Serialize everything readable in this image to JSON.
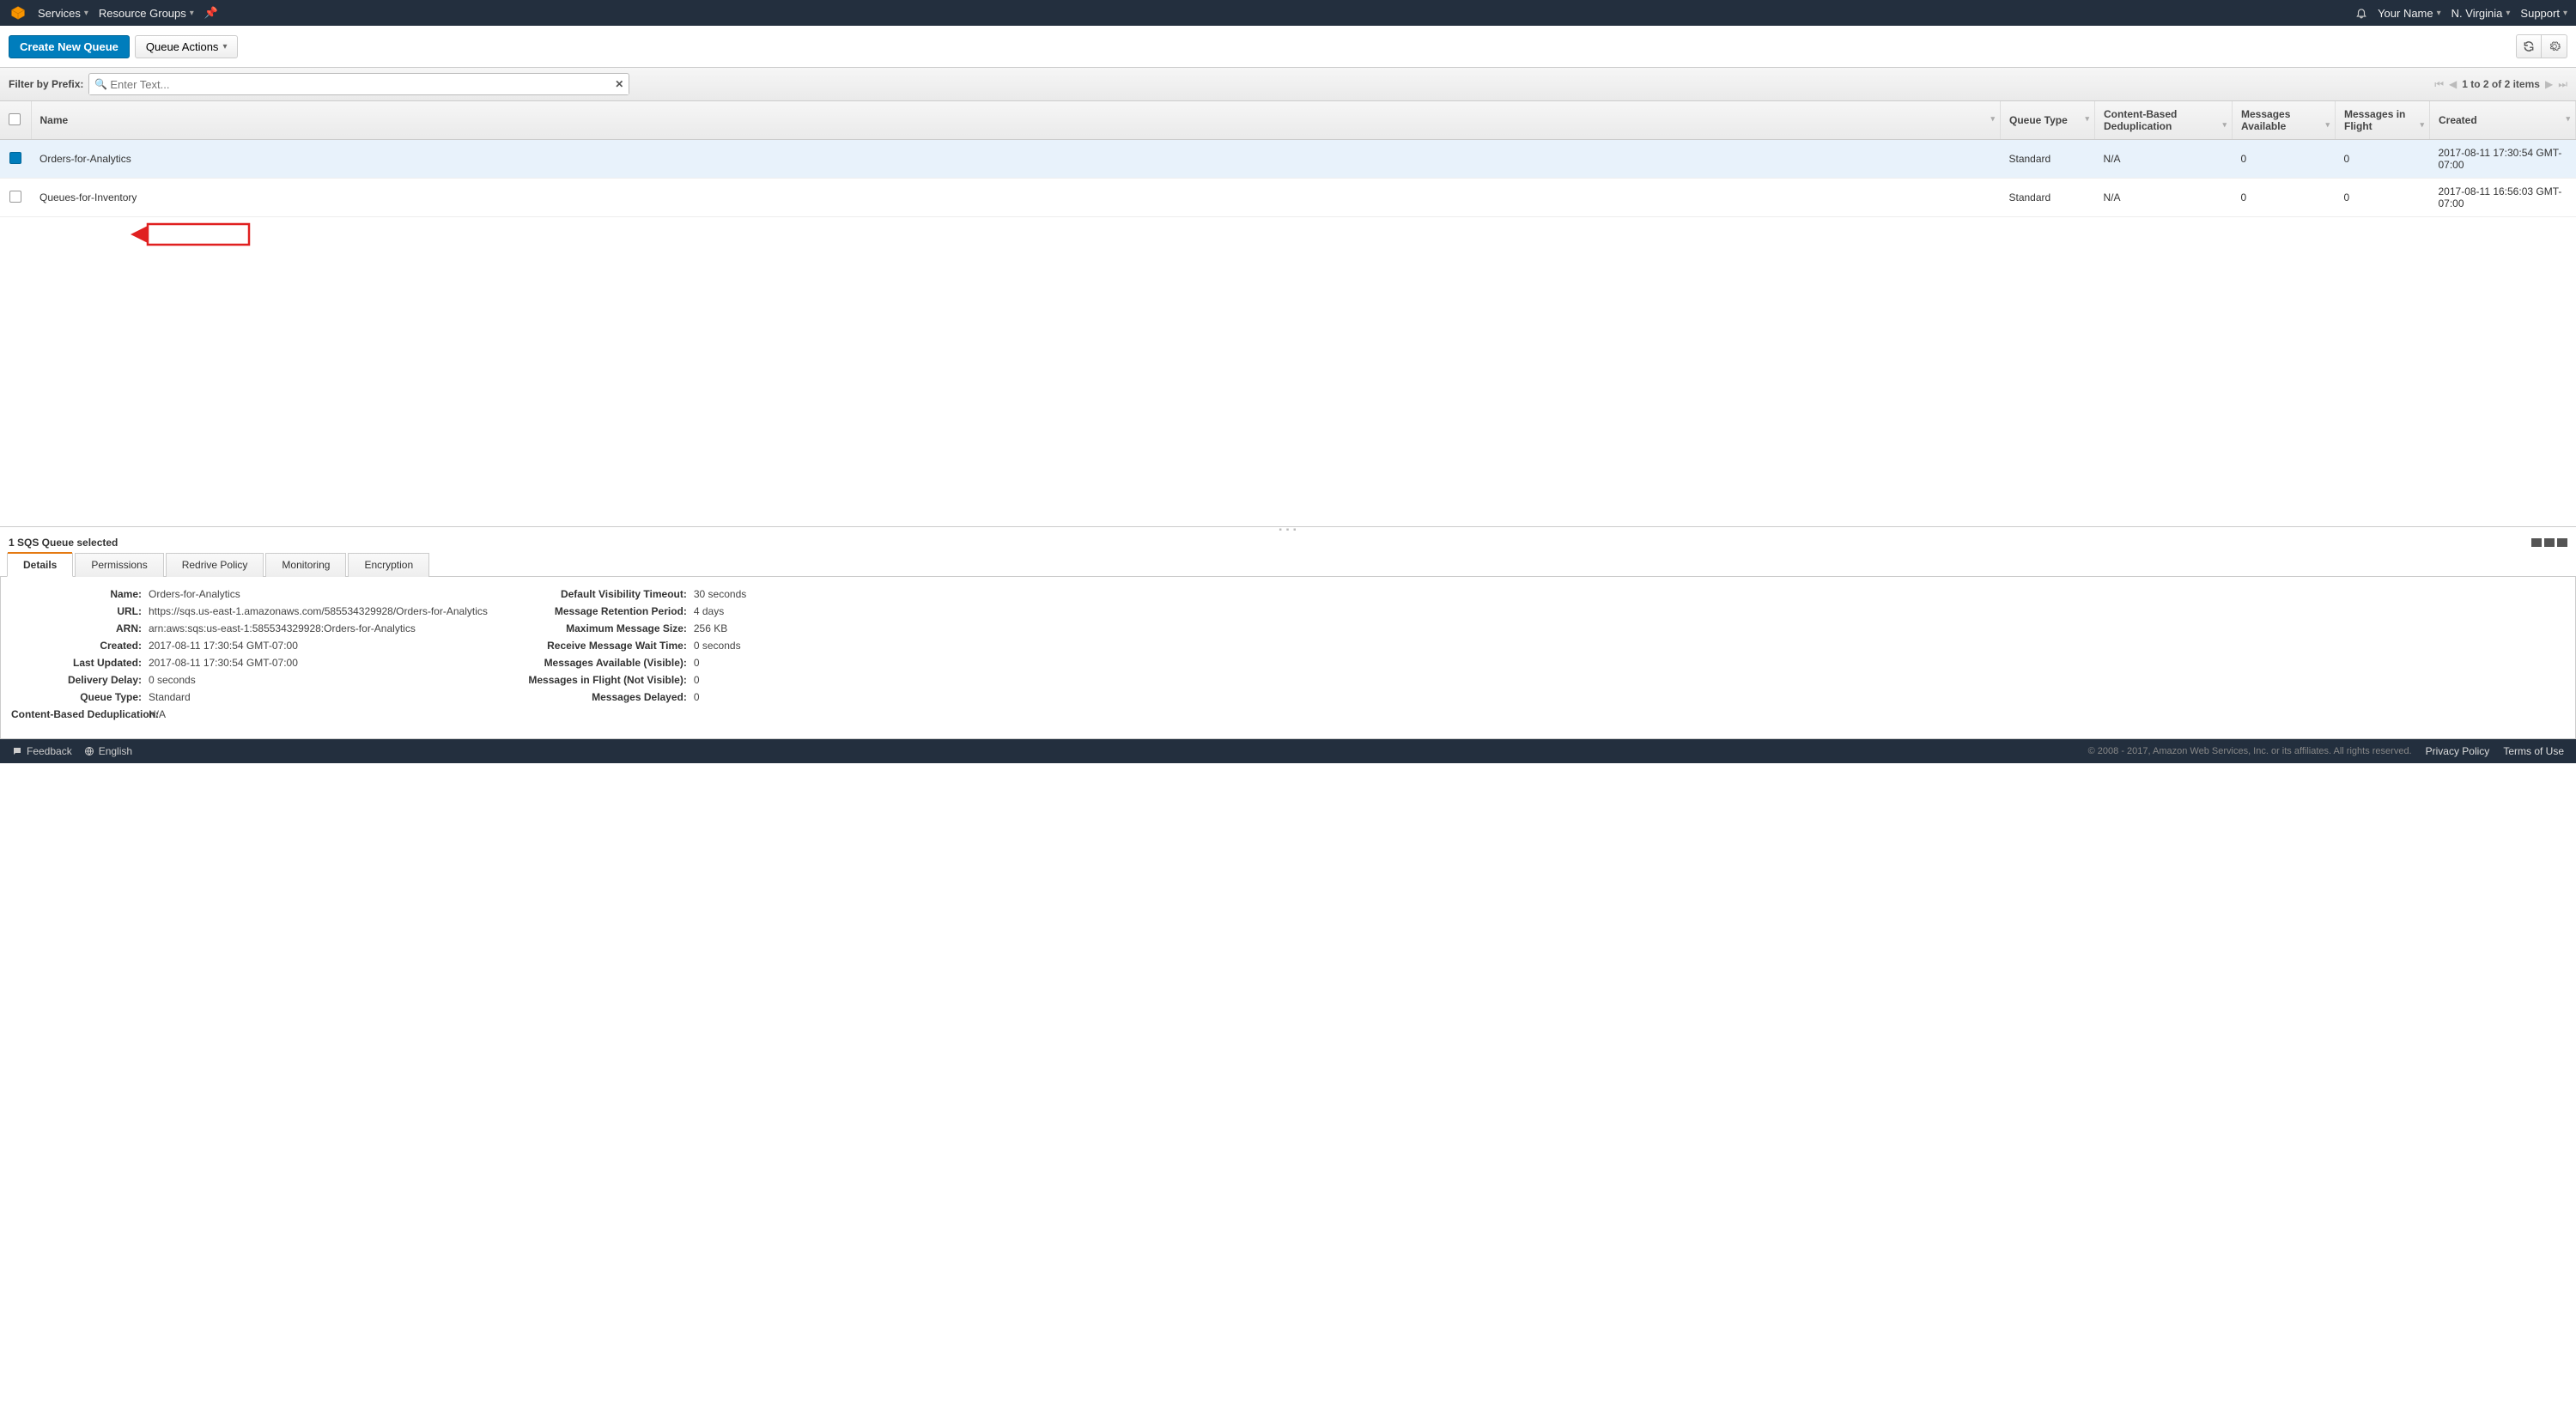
{
  "topnav": {
    "services": "Services",
    "resource_groups": "Resource Groups",
    "user": "Your Name",
    "region": "N. Virginia",
    "support": "Support"
  },
  "actionbar": {
    "create": "Create New Queue",
    "actions": "Queue Actions"
  },
  "filter": {
    "label": "Filter by Prefix:",
    "placeholder": "Enter Text..."
  },
  "pager": {
    "text": "1 to 2 of 2 items"
  },
  "table": {
    "headers": {
      "name": "Name",
      "type": "Queue Type",
      "dedup": "Content-Based Deduplication",
      "available": "Messages Available",
      "inflight": "Messages in Flight",
      "created": "Created"
    },
    "rows": [
      {
        "selected": true,
        "name": "Orders-for-Analytics",
        "type": "Standard",
        "dedup": "N/A",
        "available": "0",
        "inflight": "0",
        "created": "2017-08-11 17:30:54 GMT-07:00"
      },
      {
        "selected": false,
        "name": "Queues-for-Inventory",
        "type": "Standard",
        "dedup": "N/A",
        "available": "0",
        "inflight": "0",
        "created": "2017-08-11 16:56:03 GMT-07:00"
      }
    ]
  },
  "details": {
    "selected_text": "1 SQS Queue selected",
    "tabs": {
      "details": "Details",
      "permissions": "Permissions",
      "redrive": "Redrive Policy",
      "monitoring": "Monitoring",
      "encryption": "Encryption"
    },
    "left": {
      "name_k": "Name:",
      "name_v": "Orders-for-Analytics",
      "url_k": "URL:",
      "url_v": "https://sqs.us-east-1.amazonaws.com/585534329928/Orders-for-Analytics",
      "arn_k": "ARN:",
      "arn_v": "arn:aws:sqs:us-east-1:585534329928:Orders-for-Analytics",
      "created_k": "Created:",
      "created_v": "2017-08-11 17:30:54 GMT-07:00",
      "updated_k": "Last Updated:",
      "updated_v": "2017-08-11 17:30:54 GMT-07:00",
      "delay_k": "Delivery Delay:",
      "delay_v": "0 seconds",
      "type_k": "Queue Type:",
      "type_v": "Standard",
      "dedup_k": "Content-Based Deduplication:",
      "dedup_v": "N/A"
    },
    "right": {
      "vis_k": "Default Visibility Timeout:",
      "vis_v": "30 seconds",
      "ret_k": "Message Retention Period:",
      "ret_v": "4 days",
      "max_k": "Maximum Message Size:",
      "max_v": "256 KB",
      "wait_k": "Receive Message Wait Time:",
      "wait_v": "0 seconds",
      "avail_k": "Messages Available (Visible):",
      "avail_v": "0",
      "flight_k": "Messages in Flight (Not Visible):",
      "flight_v": "0",
      "delayed_k": "Messages Delayed:",
      "delayed_v": "0"
    }
  },
  "footer": {
    "feedback": "Feedback",
    "language": "English",
    "copy": "© 2008 - 2017, Amazon Web Services, Inc. or its affiliates. All rights reserved.",
    "privacy": "Privacy Policy",
    "terms": "Terms of Use"
  }
}
